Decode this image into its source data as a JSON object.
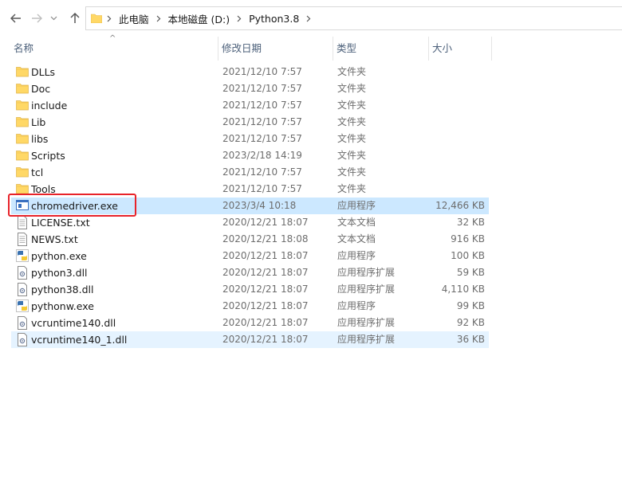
{
  "breadcrumb": [
    "此电脑",
    "本地磁盘 (D:)",
    "Python3.8"
  ],
  "columns": {
    "name": "名称",
    "date": "修改日期",
    "type": "类型",
    "size": "大小"
  },
  "files": [
    {
      "name": "DLLs",
      "date": "2021/12/10 7:57",
      "type": "文件夹",
      "size": "",
      "icon": "folder-icon"
    },
    {
      "name": "Doc",
      "date": "2021/12/10 7:57",
      "type": "文件夹",
      "size": "",
      "icon": "folder-icon"
    },
    {
      "name": "include",
      "date": "2021/12/10 7:57",
      "type": "文件夹",
      "size": "",
      "icon": "folder-icon"
    },
    {
      "name": "Lib",
      "date": "2021/12/10 7:57",
      "type": "文件夹",
      "size": "",
      "icon": "folder-icon"
    },
    {
      "name": "libs",
      "date": "2021/12/10 7:57",
      "type": "文件夹",
      "size": "",
      "icon": "folder-icon"
    },
    {
      "name": "Scripts",
      "date": "2023/2/18 14:19",
      "type": "文件夹",
      "size": "",
      "icon": "folder-icon"
    },
    {
      "name": "tcl",
      "date": "2021/12/10 7:57",
      "type": "文件夹",
      "size": "",
      "icon": "folder-icon"
    },
    {
      "name": "Tools",
      "date": "2021/12/10 7:57",
      "type": "文件夹",
      "size": "",
      "icon": "folder-icon"
    },
    {
      "name": "chromedriver.exe",
      "date": "2023/3/4 10:18",
      "type": "应用程序",
      "size": "12,466 KB",
      "icon": "exe-window-icon"
    },
    {
      "name": "LICENSE.txt",
      "date": "2020/12/21 18:07",
      "type": "文本文档",
      "size": "32 KB",
      "icon": "text-file-icon"
    },
    {
      "name": "NEWS.txt",
      "date": "2020/12/21 18:08",
      "type": "文本文档",
      "size": "916 KB",
      "icon": "text-file-icon"
    },
    {
      "name": "python.exe",
      "date": "2020/12/21 18:07",
      "type": "应用程序",
      "size": "100 KB",
      "icon": "python-icon"
    },
    {
      "name": "python3.dll",
      "date": "2020/12/21 18:07",
      "type": "应用程序扩展",
      "size": "59 KB",
      "icon": "dll-icon"
    },
    {
      "name": "python38.dll",
      "date": "2020/12/21 18:07",
      "type": "应用程序扩展",
      "size": "4,110 KB",
      "icon": "dll-icon"
    },
    {
      "name": "pythonw.exe",
      "date": "2020/12/21 18:07",
      "type": "应用程序",
      "size": "99 KB",
      "icon": "python-icon"
    },
    {
      "name": "vcruntime140.dll",
      "date": "2020/12/21 18:07",
      "type": "应用程序扩展",
      "size": "92 KB",
      "icon": "dll-icon"
    },
    {
      "name": "vcruntime140_1.dll",
      "date": "2020/12/21 18:07",
      "type": "应用程序扩展",
      "size": "36 KB",
      "icon": "dll-icon"
    }
  ],
  "selected_index": 8,
  "hover_index": 16,
  "colors": {
    "selected": "#cce8ff",
    "hover": "#e5f3ff",
    "highlight_box": "#e8232a",
    "folder": "#ffd866"
  }
}
